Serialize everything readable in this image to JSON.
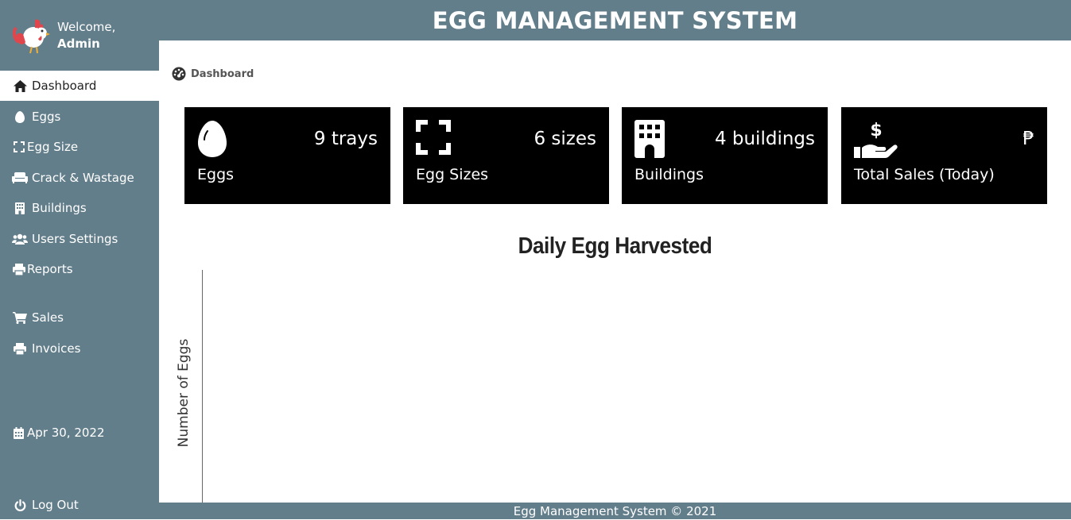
{
  "header": {
    "title": "EGG MANAGEMENT SYSTEM"
  },
  "profile": {
    "greeting": "Welcome,",
    "user": "Admin"
  },
  "sidebar": {
    "items": [
      {
        "label": "Dashboard",
        "icon": "home-icon"
      },
      {
        "label": "Eggs",
        "icon": "egg-icon"
      },
      {
        "label": "Egg Size",
        "icon": "expand-icon"
      },
      {
        "label": "Crack & Wastage",
        "icon": "couch-icon"
      },
      {
        "label": "Buildings",
        "icon": "building-icon"
      },
      {
        "label": "Users Settings",
        "icon": "users-icon"
      },
      {
        "label": "Reports",
        "icon": "print-icon"
      },
      {
        "label": "Sales",
        "icon": "cart-icon"
      },
      {
        "label": "Invoices",
        "icon": "print-icon"
      }
    ],
    "date": "Apr 30, 2022",
    "logout": "Log Out"
  },
  "breadcrumb": {
    "label": "Dashboard"
  },
  "cards": [
    {
      "value": "9 trays",
      "label": "Eggs",
      "icon": "egg-icon"
    },
    {
      "value": "6 sizes",
      "label": "Egg Sizes",
      "icon": "expand-icon"
    },
    {
      "value": "4 buildings",
      "label": "Buildings",
      "icon": "building-icon"
    },
    {
      "value": "₱",
      "label": "Total Sales (Today)",
      "icon": "hand-dollar-icon"
    }
  ],
  "chart_data": {
    "type": "bar",
    "title": "Daily Egg Harvested",
    "ylabel": "Number of Eggs",
    "categories": [],
    "values": []
  },
  "footer": {
    "text": "Egg Management System © 2021"
  },
  "colors": {
    "sidebar": "#637e8b",
    "card": "#000000",
    "active": "#ffffff"
  }
}
